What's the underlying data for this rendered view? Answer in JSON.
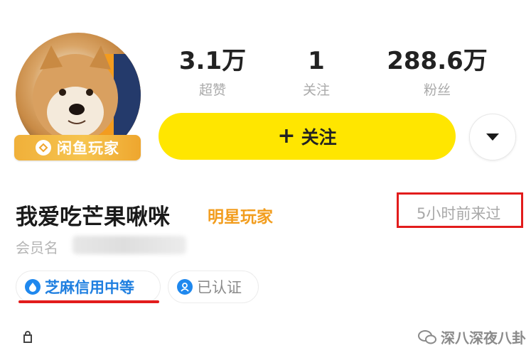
{
  "profile": {
    "avatar_badge": "闲鱼玩家",
    "username": "我爱吃芒果啾咪",
    "tag": "明星玩家",
    "last_seen": "5小时前来过",
    "member_label": "会员名"
  },
  "stats": [
    {
      "value": "3.1万",
      "label": "超赞"
    },
    {
      "value": "1",
      "label": "关注"
    },
    {
      "value": "288.6万",
      "label": "粉丝"
    }
  ],
  "actions": {
    "follow_plus": "+",
    "follow_label": "关注",
    "more_icon": "chevron-down-icon"
  },
  "badges": {
    "credit": "芝麻信用中等",
    "verified": "已认证"
  },
  "watermark": "深八深夜八卦",
  "colors": {
    "follow_button": "#ffe600",
    "credit_blue": "#1f7fe0",
    "highlight_red": "#e21c1c",
    "star_orange": "#f29d1e"
  }
}
